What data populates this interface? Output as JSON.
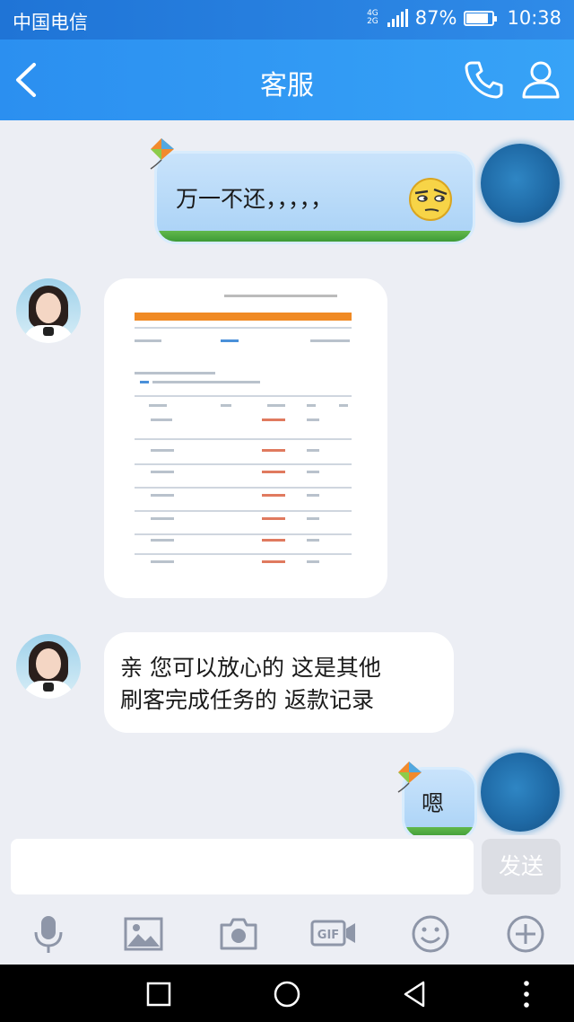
{
  "status_bar": {
    "carrier": "中国电信",
    "network": [
      "4G",
      "2G"
    ],
    "battery_percent": "87%",
    "battery_level": 0.87,
    "time": "10:38"
  },
  "header": {
    "title": "客服",
    "back_icon": "chevron-left-icon",
    "call_icon": "phone-icon",
    "profile_icon": "person-icon"
  },
  "messages": [
    {
      "sender": "me",
      "type": "text",
      "text": "万一不还，，，，，"
    },
    {
      "sender": "service",
      "type": "image",
      "description_hidden": true
    },
    {
      "sender": "service",
      "type": "text",
      "lines": [
        "亲 您可以放心的 这是其他",
        "刷客完成任务的 返款记录"
      ]
    },
    {
      "sender": "me",
      "type": "text",
      "text": "嗯"
    }
  ],
  "input": {
    "value": "",
    "send_label": "发送"
  },
  "toolbar": [
    "microphone-icon",
    "image-icon",
    "camera-icon",
    "gif-icon",
    "emoji-icon",
    "plus-icon"
  ],
  "colors": {
    "header": "#2b8ff0",
    "background": "#eceef4",
    "bubble_me": "#b3d8f8",
    "grass": "#4aa83e"
  }
}
